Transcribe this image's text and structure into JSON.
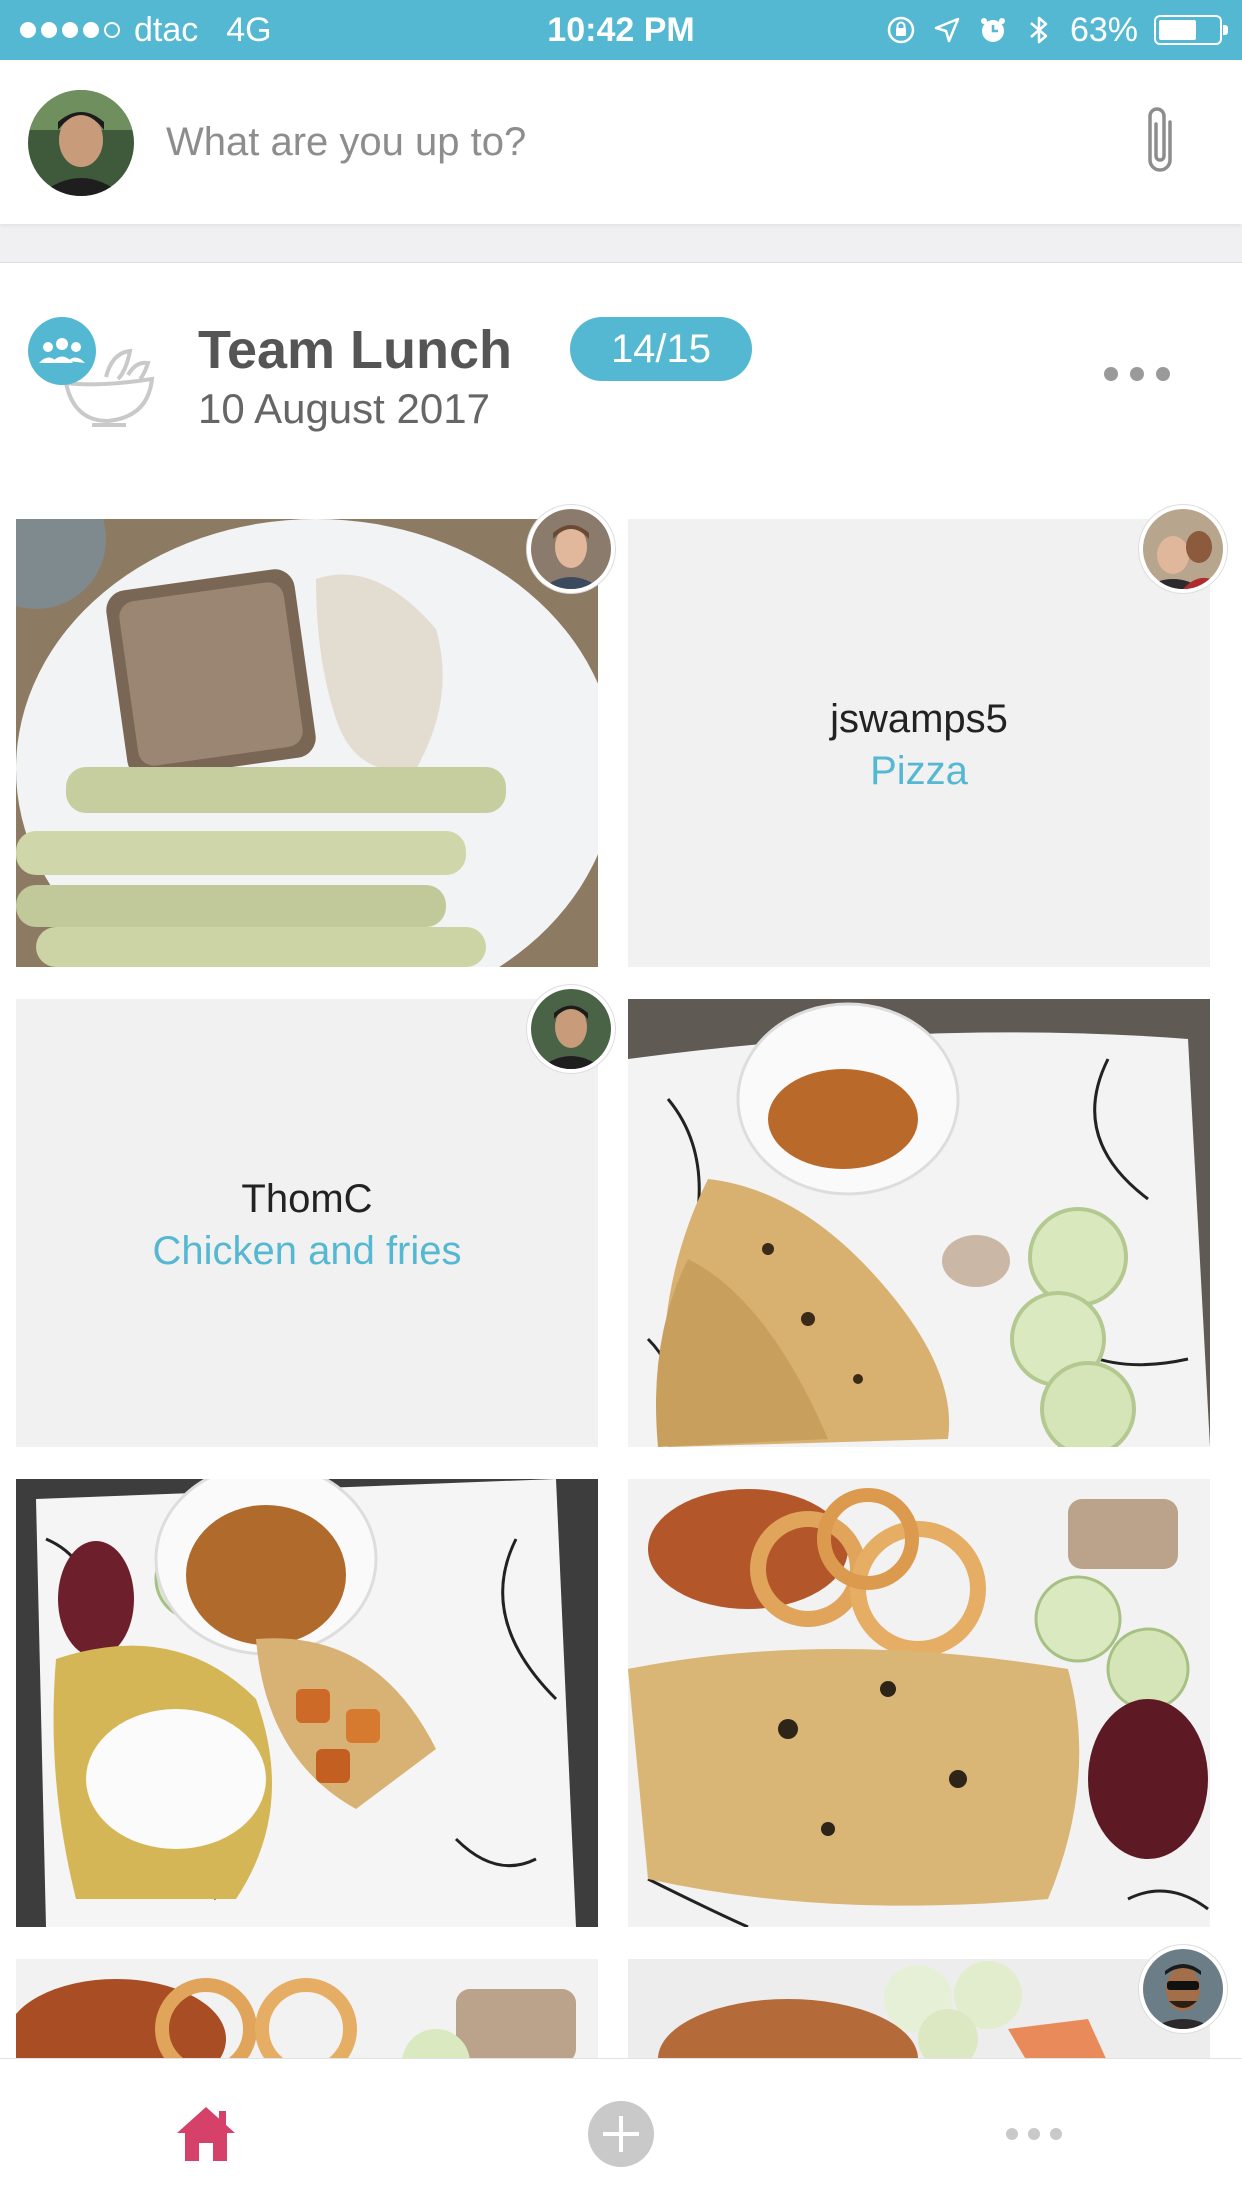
{
  "status_bar": {
    "carrier": "dtac",
    "network": "4G",
    "time": "10:42 PM",
    "battery": "63%",
    "battery_level": 0.63,
    "signal_bars": 4,
    "icons": [
      "orientation-lock-icon",
      "location-icon",
      "alarm-icon",
      "bluetooth-icon"
    ]
  },
  "composer": {
    "placeholder": "What are you up to?",
    "attach_icon": "paperclip-icon"
  },
  "event": {
    "title": "Team Lunch",
    "date": "10 August 2017",
    "count": "14/15",
    "icon": "group-salad-bowl-icon"
  },
  "tiles": [
    {
      "type": "photo",
      "photo": "plate-bread-chicken-celery"
    },
    {
      "type": "placeholder",
      "user": "jswamps5",
      "dish": "Pizza"
    },
    {
      "type": "placeholder",
      "user": "ThomC",
      "dish": "Chicken and fries"
    },
    {
      "type": "photo",
      "photo": "plate-roti-curry-cucumber"
    },
    {
      "type": "photo",
      "photo": "plate-rice-roti-dal-curd"
    },
    {
      "type": "photo",
      "photo": "plate-roti-snacks-beetroot"
    },
    {
      "type": "photo",
      "photo": "plate-snacks-partial"
    },
    {
      "type": "photo",
      "photo": "plate-cucumber-partial"
    }
  ],
  "tab_bar": {
    "items": [
      {
        "icon": "home-icon",
        "active": true
      },
      {
        "icon": "add-icon",
        "active": false
      },
      {
        "icon": "more-icon",
        "active": false
      }
    ],
    "active_color": "#d6416a"
  },
  "colors": {
    "accent": "#54b8d3"
  }
}
